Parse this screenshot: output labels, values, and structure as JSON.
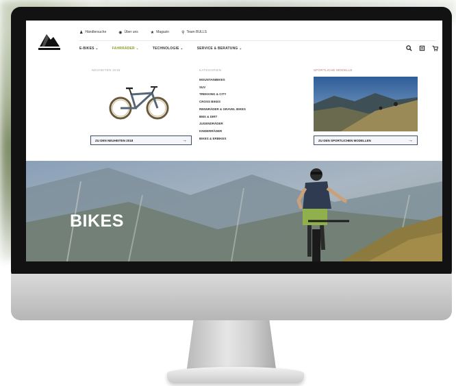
{
  "utility": {
    "items": [
      {
        "icon": "person-icon",
        "label": "Händlersuche"
      },
      {
        "icon": "pin-icon",
        "label": "Über uns"
      },
      {
        "icon": "star-icon",
        "label": "Magazin"
      },
      {
        "icon": "trophy-icon",
        "label": "Team BULLS"
      }
    ]
  },
  "nav": {
    "items": [
      {
        "label": "E-BIKES ⌄",
        "active": false
      },
      {
        "label": "FAHRRÄDER ⌄",
        "active": true
      },
      {
        "label": "TECHNOLOGIE ⌄",
        "active": false
      },
      {
        "label": "SERVICE & BERATUNG ⌄",
        "active": false
      }
    ],
    "icons": [
      "search-icon",
      "compare-icon",
      "cart-icon"
    ]
  },
  "megamenu": {
    "col1_head": "NEUHEITEN 2018",
    "col1_cta": "ZU DEN NEUHEITEN 2018",
    "col2_head": "KATEGORIEN",
    "categories": [
      "MOUNTAINBIKES",
      "SUV",
      "TREKKING & CITY",
      "CROSS BIKES",
      "RENNRÄDER & GRAVEL BIKES",
      "BMX & DIRT",
      "JUGENDRÄDER",
      "KINDERRÄDER",
      "BIKES & ERBIKES"
    ],
    "col3_head": "SPORTLICHE MODELLE",
    "col3_cta": "ZU DEN SPORTLICHEN MODELLEN"
  },
  "hero": {
    "title": "BIKES"
  },
  "colors": {
    "accent": "#8a9a2a",
    "cta_border": "#3c4c66"
  }
}
